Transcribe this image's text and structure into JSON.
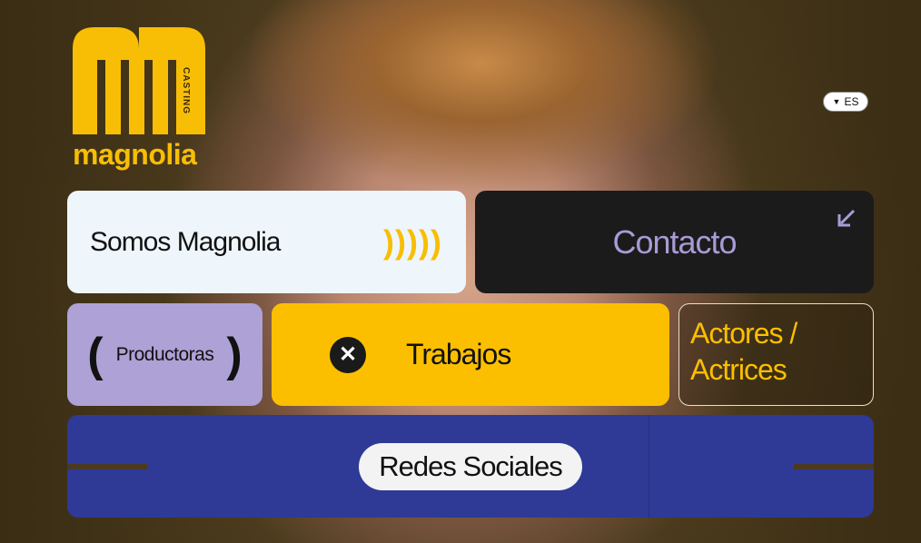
{
  "brand": {
    "name": "magnolia",
    "tag": "CASTING",
    "color": "#f7be05"
  },
  "language": {
    "selected": "ES"
  },
  "nav": {
    "somos": {
      "label": "Somos Magnolia",
      "decoration": ")))))"
    },
    "contacto": {
      "label": "Contacto"
    },
    "productoras": {
      "label": "Productoras",
      "paren_open": "(",
      "paren_close": ")"
    },
    "trabajos": {
      "label": "Trabajos",
      "icon": "close-icon"
    },
    "actores": {
      "line1": "Actores /",
      "line2": "Actrices"
    },
    "redes": {
      "label": "Redes Sociales"
    }
  },
  "colors": {
    "accent_yellow": "#fcbf00",
    "lavender": "#ada1d6",
    "navy": "#2e3a96",
    "dark": "#1b1b1b",
    "light": "#eef6fc"
  }
}
